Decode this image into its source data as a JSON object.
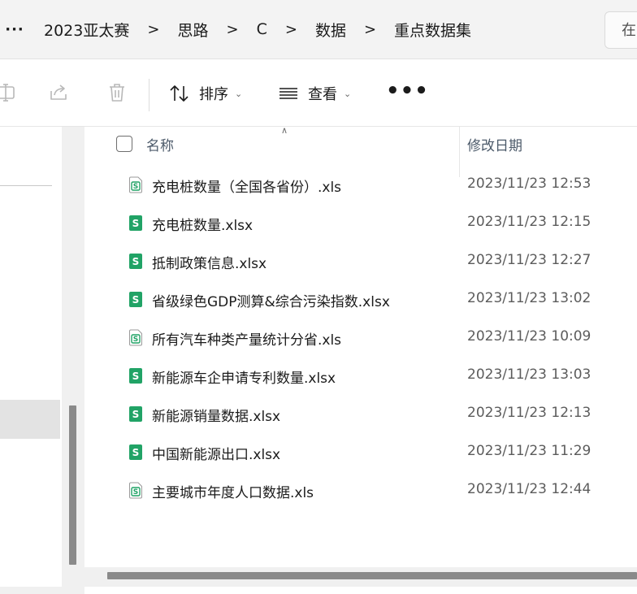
{
  "breadcrumb": {
    "more_label": "···",
    "items": [
      "2023亚太赛",
      "思路",
      "C",
      "数据",
      "重点数据集"
    ],
    "separator": ">"
  },
  "search": {
    "placeholder": "在"
  },
  "toolbar": {
    "icons": [
      "rename-icon",
      "share-icon",
      "delete-icon"
    ],
    "sort_label": "排序",
    "view_label": "查看",
    "more_label": "•••"
  },
  "columns": {
    "name": "名称",
    "date_modified": "修改日期"
  },
  "files": [
    {
      "name": "充电桩数量（全国各省份）.xls",
      "date": "2023/11/23 12:53",
      "icon": "xls-file-icon"
    },
    {
      "name": "充电桩数量.xlsx",
      "date": "2023/11/23 12:15",
      "icon": "xlsx-file-icon"
    },
    {
      "name": "抵制政策信息.xlsx",
      "date": "2023/11/23 12:27",
      "icon": "xlsx-file-icon"
    },
    {
      "name": "省级绿色GDP测算&综合污染指数.xlsx",
      "date": "2023/11/23 13:02",
      "icon": "xlsx-file-icon"
    },
    {
      "name": "所有汽车种类产量统计分省.xls",
      "date": "2023/11/23 10:09",
      "icon": "xls-file-icon"
    },
    {
      "name": "新能源车企申请专利数量.xlsx",
      "date": "2023/11/23 13:03",
      "icon": "xlsx-file-icon"
    },
    {
      "name": "新能源销量数据.xlsx",
      "date": "2023/11/23 12:13",
      "icon": "xlsx-file-icon"
    },
    {
      "name": "中国新能源出口.xlsx",
      "date": "2023/11/23 11:29",
      "icon": "xlsx-file-icon"
    },
    {
      "name": "主要城市年度人口数据.xls",
      "date": "2023/11/23 12:44",
      "icon": "xls-file-icon"
    }
  ],
  "colors": {
    "xlsx_icon": "#21a366",
    "xls_icon_outline": "#21a366",
    "header_text": "#4c5a6a"
  }
}
